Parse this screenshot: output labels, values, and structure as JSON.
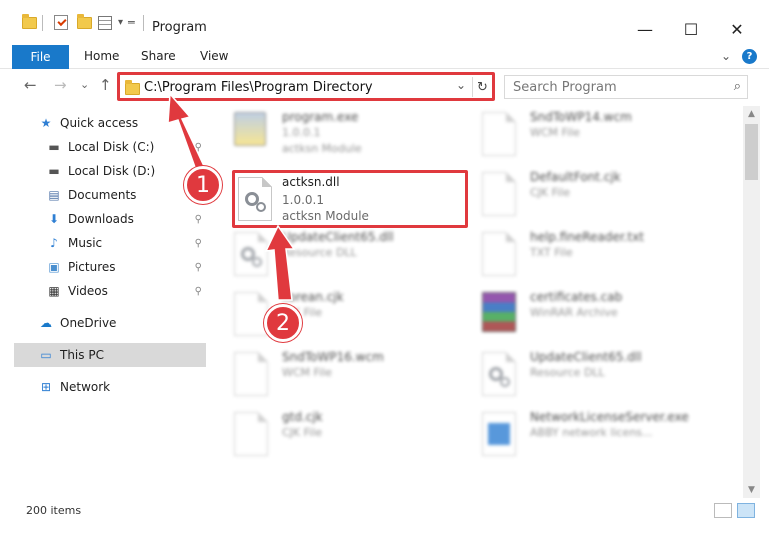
{
  "window": {
    "title": "Program",
    "minimize": "—",
    "maximize": "☐",
    "close": "✕"
  },
  "ribbon": {
    "tabs": [
      "File",
      "Home",
      "Share",
      "View"
    ],
    "collapse": "⌄",
    "help": "?"
  },
  "nav": {
    "back": "←",
    "forward": "→",
    "recent": "⌄",
    "up": "↑",
    "address": "C:\\Program Files\\Program Directory",
    "address_dropdown": "⌄",
    "refresh": "↻",
    "search_placeholder": "Search Program",
    "search_icon": "⌕"
  },
  "sidebar": {
    "items": [
      {
        "label": "Quick access",
        "icon": "star-icon",
        "glyph": "★",
        "color": "#2f7fd3",
        "pinned": false
      },
      {
        "label": "Local Disk (C:)",
        "icon": "drive-icon",
        "glyph": "▬",
        "color": "#555555",
        "pinned": true
      },
      {
        "label": "Local Disk (D:)",
        "icon": "drive-icon",
        "glyph": "▬",
        "color": "#555555",
        "pinned": true
      },
      {
        "label": "Documents",
        "icon": "documents-icon",
        "glyph": "▤",
        "color": "#4a6fa5",
        "pinned": true
      },
      {
        "label": "Downloads",
        "icon": "download-icon",
        "glyph": "⬇",
        "color": "#2f7fd3",
        "pinned": true
      },
      {
        "label": "Music",
        "icon": "music-icon",
        "glyph": "♪",
        "color": "#2f7fd3",
        "pinned": true
      },
      {
        "label": "Pictures",
        "icon": "pictures-icon",
        "glyph": "▣",
        "color": "#4a8fcf",
        "pinned": true
      },
      {
        "label": "Videos",
        "icon": "video-icon",
        "glyph": "▦",
        "color": "#333333",
        "pinned": true
      },
      {
        "label": "OneDrive",
        "icon": "cloud-icon",
        "glyph": "☁",
        "color": "#1979ca",
        "pinned": false
      },
      {
        "label": "This PC",
        "icon": "monitor-icon",
        "glyph": "▭",
        "color": "#2f7fd3",
        "pinned": false,
        "selected": true
      },
      {
        "label": "Network",
        "icon": "network-icon",
        "glyph": "⊞",
        "color": "#2f7fd3",
        "pinned": false
      }
    ],
    "pin_glyph": "📌"
  },
  "files": [
    {
      "name": "program.exe",
      "sub": "1.0.0.1",
      "sub2": "actksn Module",
      "kind": "exe"
    },
    {
      "name": "SndToWP14.wcm",
      "sub": "WCM File",
      "sub2": "",
      "kind": "doc"
    },
    {
      "name": "DefaultFont.cjk",
      "sub": "CJK File",
      "sub2": "",
      "kind": "doc"
    },
    {
      "name": "UpdateClient65.dll",
      "sub": "Resource DLL",
      "sub2": "",
      "kind": "dll"
    },
    {
      "name": "help.fineReader.txt",
      "sub": "TXT File",
      "sub2": "",
      "kind": "doc"
    },
    {
      "name": "korean.cjk",
      "sub": "CJK File",
      "sub2": "",
      "kind": "doc"
    },
    {
      "name": "certificates.cab",
      "sub": "WinRAR Archive",
      "sub2": "",
      "kind": "rar"
    },
    {
      "name": "SndToWP16.wcm",
      "sub": "WCM File",
      "sub2": "",
      "kind": "doc"
    },
    {
      "name": "UpdateClient65.dll",
      "sub": "Resource DLL",
      "sub2": "",
      "kind": "dll"
    },
    {
      "name": "gtd.cjk",
      "sub": "CJK File",
      "sub2": "",
      "kind": "doc"
    },
    {
      "name": "NetworkLicenseServer.exe",
      "sub": "ABBY network licens...",
      "sub2": "",
      "kind": "netapp"
    }
  ],
  "highlighted_file": {
    "name": "actksn.dll",
    "version": "1.0.0.1",
    "description": "actksn Module"
  },
  "callouts": [
    "1",
    "2"
  ],
  "status": {
    "count": "200 items"
  },
  "colors": {
    "accent": "#1979ca",
    "annotation": "#e0393e"
  }
}
